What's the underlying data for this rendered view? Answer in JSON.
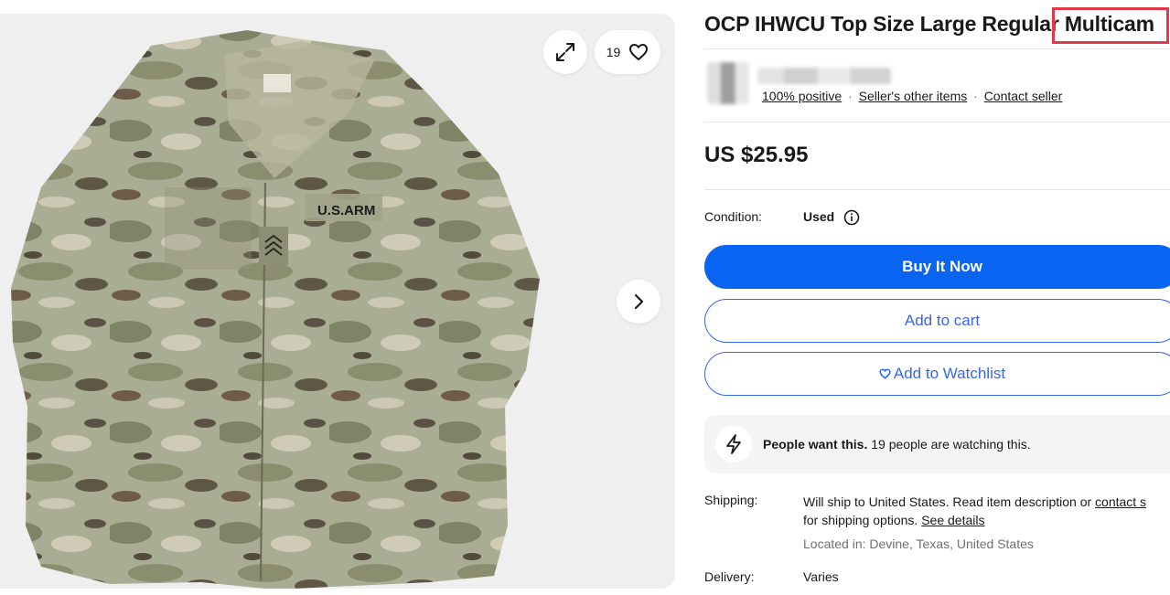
{
  "gallery": {
    "watchers_count": "19",
    "patch_text": "U.S.ARM",
    "icons": [
      "expand-icon",
      "heart-icon",
      "chevron-right-icon"
    ]
  },
  "listing": {
    "title": "OCP IHWCU Top Size Large Regular Multicam",
    "price": "US $25.95",
    "condition_label": "Condition:",
    "condition_value": "Used"
  },
  "seller": {
    "feedback": "100% positive",
    "other_items": "Seller's other items",
    "contact": "Contact seller",
    "separator": "·"
  },
  "actions": {
    "buy_now": "Buy It Now",
    "add_to_cart": "Add to cart",
    "add_to_watchlist": "Add to Watchlist"
  },
  "signal": {
    "bold": "People want this.",
    "text": " 19 people are watching this."
  },
  "shipping": {
    "label": "Shipping:",
    "text_before": "Will ship to United States. Read item description or ",
    "contact_link": "contact s",
    "text_after": "for shipping options. ",
    "details_link": "See details",
    "location": "Located in: Devine, Texas, United States"
  },
  "delivery": {
    "label": "Delivery:",
    "value": "Varies"
  },
  "colors": {
    "primary_blue": "#0964f2",
    "link_blue": "#3665f3",
    "highlight_red": "#e0394a"
  }
}
